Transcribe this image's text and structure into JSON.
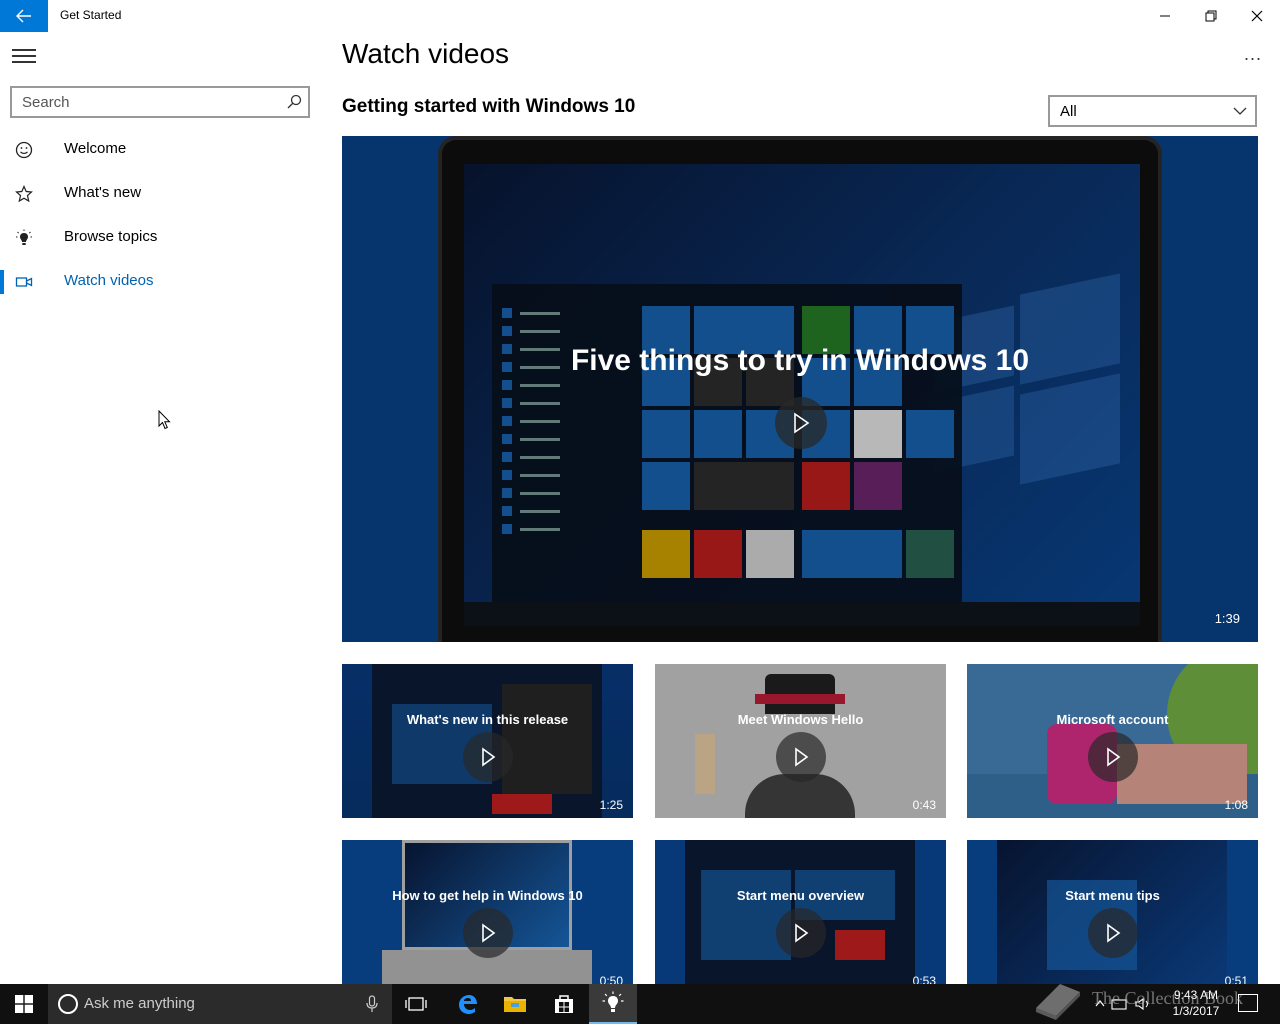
{
  "window": {
    "title": "Get Started"
  },
  "sidebar": {
    "search_placeholder": "Search",
    "items": [
      {
        "label": "Welcome",
        "icon": "smiley-icon"
      },
      {
        "label": "What's new",
        "icon": "star-icon"
      },
      {
        "label": "Browse topics",
        "icon": "lightbulb-icon"
      },
      {
        "label": "Watch videos",
        "icon": "video-icon",
        "active": true
      }
    ]
  },
  "main": {
    "page_title": "Watch videos",
    "more_label": "...",
    "section_title": "Getting started with Windows 10",
    "filter": {
      "selected": "All"
    },
    "featured": {
      "title": "Five things to try in Windows 10",
      "duration": "1:39"
    },
    "videos": [
      {
        "title": "What's new in this release",
        "duration": "1:25"
      },
      {
        "title": "Meet Windows Hello",
        "duration": "0:43"
      },
      {
        "title": "Microsoft account",
        "duration": "1:08"
      },
      {
        "title": "How to get help in Windows 10",
        "duration": "0:50"
      },
      {
        "title": "Start menu overview",
        "duration": "0:53"
      },
      {
        "title": "Start menu tips",
        "duration": "0:51"
      }
    ]
  },
  "taskbar": {
    "search_placeholder": "Ask me anything",
    "time": "9:43 AM",
    "date": "1/3/2017"
  },
  "watermark": {
    "text": "The Collection Book"
  },
  "colors": {
    "accent": "#0078d7",
    "hero_bg": "#074a96",
    "taskbar": "#101010"
  }
}
